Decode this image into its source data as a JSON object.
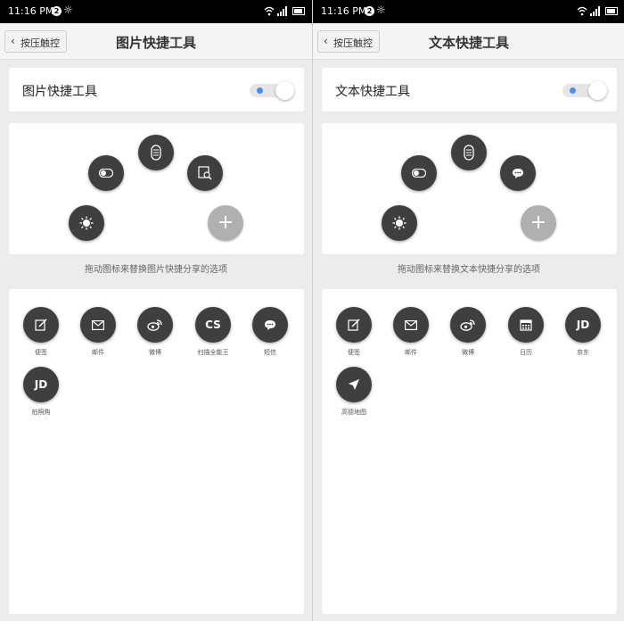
{
  "status": {
    "time": "11:16 PM",
    "badge": "2"
  },
  "left": {
    "back_label": "按压触控",
    "title": "图片快捷工具",
    "toggle_label": "图片快捷工具",
    "hint": "拖动图标来替换图片快捷分享的选项",
    "arc_icons": [
      "toggle-icon",
      "ruler-icon",
      "image-search-icon",
      "brightness-icon",
      "add-icon"
    ],
    "apps": [
      {
        "name": "便签",
        "icon": "note-icon"
      },
      {
        "name": "邮件",
        "icon": "mail-icon"
      },
      {
        "name": "微博",
        "icon": "weibo-icon"
      },
      {
        "name": "扫描全能王",
        "icon": "camscanner-icon",
        "text": "CS"
      },
      {
        "name": "短信",
        "icon": "message-icon"
      },
      {
        "name": "拍照购",
        "icon": "jd-icon",
        "text": "JD"
      }
    ]
  },
  "right": {
    "back_label": "按压触控",
    "title": "文本快捷工具",
    "toggle_label": "文本快捷工具",
    "hint": "拖动图标来替换文本快捷分享的选项",
    "arc_icons": [
      "toggle-icon",
      "ruler-icon",
      "message-icon",
      "brightness-icon",
      "add-icon"
    ],
    "apps": [
      {
        "name": "便签",
        "icon": "note-icon"
      },
      {
        "name": "邮件",
        "icon": "mail-icon"
      },
      {
        "name": "微博",
        "icon": "weibo-icon"
      },
      {
        "name": "日历",
        "icon": "calendar-icon"
      },
      {
        "name": "京东",
        "icon": "jd-icon",
        "text": "JD"
      },
      {
        "name": "高德地图",
        "icon": "navigation-icon"
      }
    ]
  },
  "colors": {
    "icon_bg": "#3f3f3f",
    "toggle_dot": "#4a8ef0",
    "add_bg": "#b0b0b0"
  }
}
